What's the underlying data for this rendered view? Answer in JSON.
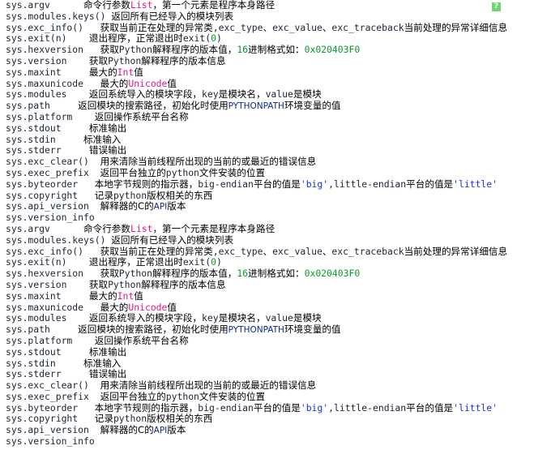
{
  "colors": {
    "code": "#1a2433",
    "chinese": "#000000",
    "type_keyword": "#e0188c",
    "number": "#0b9a2a",
    "string": "#1c2fe6",
    "background": "#ffffff",
    "help_icon": "#6ed66a"
  },
  "help_icon": {
    "glyph": "?",
    "name": "help-icon"
  },
  "lines": [
    [
      {
        "t": "sys.argv      ",
        "c": "code"
      },
      {
        "t": "命令行参数",
        "c": "zh"
      },
      {
        "t": "List",
        "c": "type"
      },
      {
        "t": "，第一个元素是程序本身路径",
        "c": "zh"
      }
    ],
    [
      {
        "t": "sys.modules.keys() ",
        "c": "code"
      },
      {
        "t": "返回所有已经导入的模块列表",
        "c": "zh"
      }
    ],
    [
      {
        "t": "sys.exc_info()   ",
        "c": "code"
      },
      {
        "t": "获取当前正在处理的异常类",
        "c": "zh"
      },
      {
        "t": ",exc_type",
        "c": "code"
      },
      {
        "t": "、",
        "c": "zh"
      },
      {
        "t": "exc_value",
        "c": "code"
      },
      {
        "t": "、",
        "c": "zh"
      },
      {
        "t": "exc_traceback",
        "c": "code"
      },
      {
        "t": "当前处理的异常详细信息",
        "c": "zh"
      }
    ],
    [
      {
        "t": "sys.exit(n)    ",
        "c": "code"
      },
      {
        "t": "退出程序，正常退出时",
        "c": "zh"
      },
      {
        "t": "exit(",
        "c": "code"
      },
      {
        "t": "0",
        "c": "num"
      },
      {
        "t": ")",
        "c": "code"
      }
    ],
    [
      {
        "t": "sys.hexversion   ",
        "c": "code"
      },
      {
        "t": "获取",
        "c": "zh"
      },
      {
        "t": "Python",
        "c": "code"
      },
      {
        "t": "解释程序的版本值，",
        "c": "zh"
      },
      {
        "t": "16",
        "c": "num"
      },
      {
        "t": "进制格式如：",
        "c": "zh"
      },
      {
        "t": "0x020403F0",
        "c": "num"
      }
    ],
    [
      {
        "t": "sys.version    ",
        "c": "code"
      },
      {
        "t": "获取",
        "c": "zh"
      },
      {
        "t": "Python",
        "c": "code"
      },
      {
        "t": "解释程序的版本信息",
        "c": "zh"
      }
    ],
    [
      {
        "t": "sys.maxint     ",
        "c": "code"
      },
      {
        "t": "最大的",
        "c": "zh"
      },
      {
        "t": "Int",
        "c": "type"
      },
      {
        "t": "值",
        "c": "zh"
      }
    ],
    [
      {
        "t": "sys.maxunicode   ",
        "c": "code"
      },
      {
        "t": "最大的",
        "c": "zh"
      },
      {
        "t": "Unicode",
        "c": "type"
      },
      {
        "t": "值",
        "c": "zh"
      }
    ],
    [
      {
        "t": "sys.modules    ",
        "c": "code"
      },
      {
        "t": "返回系统导入的模块字段，",
        "c": "zh"
      },
      {
        "t": "key",
        "c": "code"
      },
      {
        "t": "是模块名，",
        "c": "zh"
      },
      {
        "t": "value",
        "c": "code"
      },
      {
        "t": "是模块",
        "c": "zh"
      }
    ],
    [
      {
        "t": "sys.path     ",
        "c": "code"
      },
      {
        "t": "返回模块的搜索路径，初始化时使用",
        "c": "zh"
      },
      {
        "t": "PYTHONPATH",
        "c": "const"
      },
      {
        "t": "环境变量的值",
        "c": "zh"
      }
    ],
    [
      {
        "t": "sys.platform    ",
        "c": "code"
      },
      {
        "t": "返回操作系统平台名称",
        "c": "zh"
      }
    ],
    [
      {
        "t": "sys.stdout     ",
        "c": "code"
      },
      {
        "t": "标准输出",
        "c": "zh"
      }
    ],
    [
      {
        "t": "sys.stdin     ",
        "c": "code"
      },
      {
        "t": "标准输入",
        "c": "zh"
      }
    ],
    [
      {
        "t": "sys.stderr     ",
        "c": "code"
      },
      {
        "t": "错误输出",
        "c": "zh"
      }
    ],
    [
      {
        "t": "sys.exc_clear()  ",
        "c": "code"
      },
      {
        "t": "用来清除当前线程所出现的当前的或最近的错误信息",
        "c": "zh"
      }
    ],
    [
      {
        "t": "sys.exec_prefix  ",
        "c": "code"
      },
      {
        "t": "返回平台独立的",
        "c": "zh"
      },
      {
        "t": "python",
        "c": "code"
      },
      {
        "t": "文件安装的位置",
        "c": "zh"
      }
    ],
    [
      {
        "t": "sys.byteorder   ",
        "c": "code"
      },
      {
        "t": "本地字节规则的指示器，",
        "c": "zh"
      },
      {
        "t": "big-endian",
        "c": "code"
      },
      {
        "t": "平台的值是",
        "c": "zh"
      },
      {
        "t": "'big'",
        "c": "str"
      },
      {
        "t": ",little-endian",
        "c": "code"
      },
      {
        "t": "平台的值是",
        "c": "zh"
      },
      {
        "t": "'little'",
        "c": "str"
      }
    ],
    [
      {
        "t": "sys.copyright   ",
        "c": "code"
      },
      {
        "t": "记录",
        "c": "zh"
      },
      {
        "t": "python",
        "c": "code"
      },
      {
        "t": "版权相关的东西",
        "c": "zh"
      }
    ],
    [
      {
        "t": "sys.api_version  ",
        "c": "code"
      },
      {
        "t": "解释器的C的",
        "c": "zh"
      },
      {
        "t": "API",
        "c": "const"
      },
      {
        "t": "版本",
        "c": "zh"
      }
    ],
    [
      {
        "t": "sys.version_info",
        "c": "code"
      }
    ],
    [
      {
        "t": "sys.argv      ",
        "c": "code"
      },
      {
        "t": "命令行参数",
        "c": "zh"
      },
      {
        "t": "List",
        "c": "type"
      },
      {
        "t": "，第一个元素是程序本身路径",
        "c": "zh"
      }
    ],
    [
      {
        "t": "sys.modules.keys() ",
        "c": "code"
      },
      {
        "t": "返回所有已经导入的模块列表",
        "c": "zh"
      }
    ],
    [
      {
        "t": "sys.exc_info()   ",
        "c": "code"
      },
      {
        "t": "获取当前正在处理的异常类",
        "c": "zh"
      },
      {
        "t": ",exc_type",
        "c": "code"
      },
      {
        "t": "、",
        "c": "zh"
      },
      {
        "t": "exc_value",
        "c": "code"
      },
      {
        "t": "、",
        "c": "zh"
      },
      {
        "t": "exc_traceback",
        "c": "code"
      },
      {
        "t": "当前处理的异常详细信息",
        "c": "zh"
      }
    ],
    [
      {
        "t": "sys.exit(n)    ",
        "c": "code"
      },
      {
        "t": "退出程序，正常退出时",
        "c": "zh"
      },
      {
        "t": "exit(",
        "c": "code"
      },
      {
        "t": "0",
        "c": "num"
      },
      {
        "t": ")",
        "c": "code"
      }
    ],
    [
      {
        "t": "sys.hexversion   ",
        "c": "code"
      },
      {
        "t": "获取",
        "c": "zh"
      },
      {
        "t": "Python",
        "c": "code"
      },
      {
        "t": "解释程序的版本值，",
        "c": "zh"
      },
      {
        "t": "16",
        "c": "num"
      },
      {
        "t": "进制格式如：",
        "c": "zh"
      },
      {
        "t": "0x020403F0",
        "c": "num"
      }
    ],
    [
      {
        "t": "sys.version    ",
        "c": "code"
      },
      {
        "t": "获取",
        "c": "zh"
      },
      {
        "t": "Python",
        "c": "code"
      },
      {
        "t": "解释程序的版本信息",
        "c": "zh"
      }
    ],
    [
      {
        "t": "sys.maxint     ",
        "c": "code"
      },
      {
        "t": "最大的",
        "c": "zh"
      },
      {
        "t": "Int",
        "c": "type"
      },
      {
        "t": "值",
        "c": "zh"
      }
    ],
    [
      {
        "t": "sys.maxunicode   ",
        "c": "code"
      },
      {
        "t": "最大的",
        "c": "zh"
      },
      {
        "t": "Unicode",
        "c": "type"
      },
      {
        "t": "值",
        "c": "zh"
      }
    ],
    [
      {
        "t": "sys.modules    ",
        "c": "code"
      },
      {
        "t": "返回系统导入的模块字段，",
        "c": "zh"
      },
      {
        "t": "key",
        "c": "code"
      },
      {
        "t": "是模块名，",
        "c": "zh"
      },
      {
        "t": "value",
        "c": "code"
      },
      {
        "t": "是模块",
        "c": "zh"
      }
    ],
    [
      {
        "t": "sys.path     ",
        "c": "code"
      },
      {
        "t": "返回模块的搜索路径，初始化时使用",
        "c": "zh"
      },
      {
        "t": "PYTHONPATH",
        "c": "const"
      },
      {
        "t": "环境变量的值",
        "c": "zh"
      }
    ],
    [
      {
        "t": "sys.platform    ",
        "c": "code"
      },
      {
        "t": "返回操作系统平台名称",
        "c": "zh"
      }
    ],
    [
      {
        "t": "sys.stdout     ",
        "c": "code"
      },
      {
        "t": "标准输出",
        "c": "zh"
      }
    ],
    [
      {
        "t": "sys.stdin     ",
        "c": "code"
      },
      {
        "t": "标准输入",
        "c": "zh"
      }
    ],
    [
      {
        "t": "sys.stderr     ",
        "c": "code"
      },
      {
        "t": "错误输出",
        "c": "zh"
      }
    ],
    [
      {
        "t": "sys.exc_clear()  ",
        "c": "code"
      },
      {
        "t": "用来清除当前线程所出现的当前的或最近的错误信息",
        "c": "zh"
      }
    ],
    [
      {
        "t": "sys.exec_prefix  ",
        "c": "code"
      },
      {
        "t": "返回平台独立的",
        "c": "zh"
      },
      {
        "t": "python",
        "c": "code"
      },
      {
        "t": "文件安装的位置",
        "c": "zh"
      }
    ],
    [
      {
        "t": "sys.byteorder   ",
        "c": "code"
      },
      {
        "t": "本地字节规则的指示器，",
        "c": "zh"
      },
      {
        "t": "big-endian",
        "c": "code"
      },
      {
        "t": "平台的值是",
        "c": "zh"
      },
      {
        "t": "'big'",
        "c": "str"
      },
      {
        "t": ",little-endian",
        "c": "code"
      },
      {
        "t": "平台的值是",
        "c": "zh"
      },
      {
        "t": "'little'",
        "c": "str"
      }
    ],
    [
      {
        "t": "sys.copyright   ",
        "c": "code"
      },
      {
        "t": "记录",
        "c": "zh"
      },
      {
        "t": "python",
        "c": "code"
      },
      {
        "t": "版权相关的东西",
        "c": "zh"
      }
    ],
    [
      {
        "t": "sys.api_version  ",
        "c": "code"
      },
      {
        "t": "解释器的C的",
        "c": "zh"
      },
      {
        "t": "API",
        "c": "const"
      },
      {
        "t": "版本",
        "c": "zh"
      }
    ],
    [
      {
        "t": "sys.version_info",
        "c": "code"
      }
    ]
  ]
}
